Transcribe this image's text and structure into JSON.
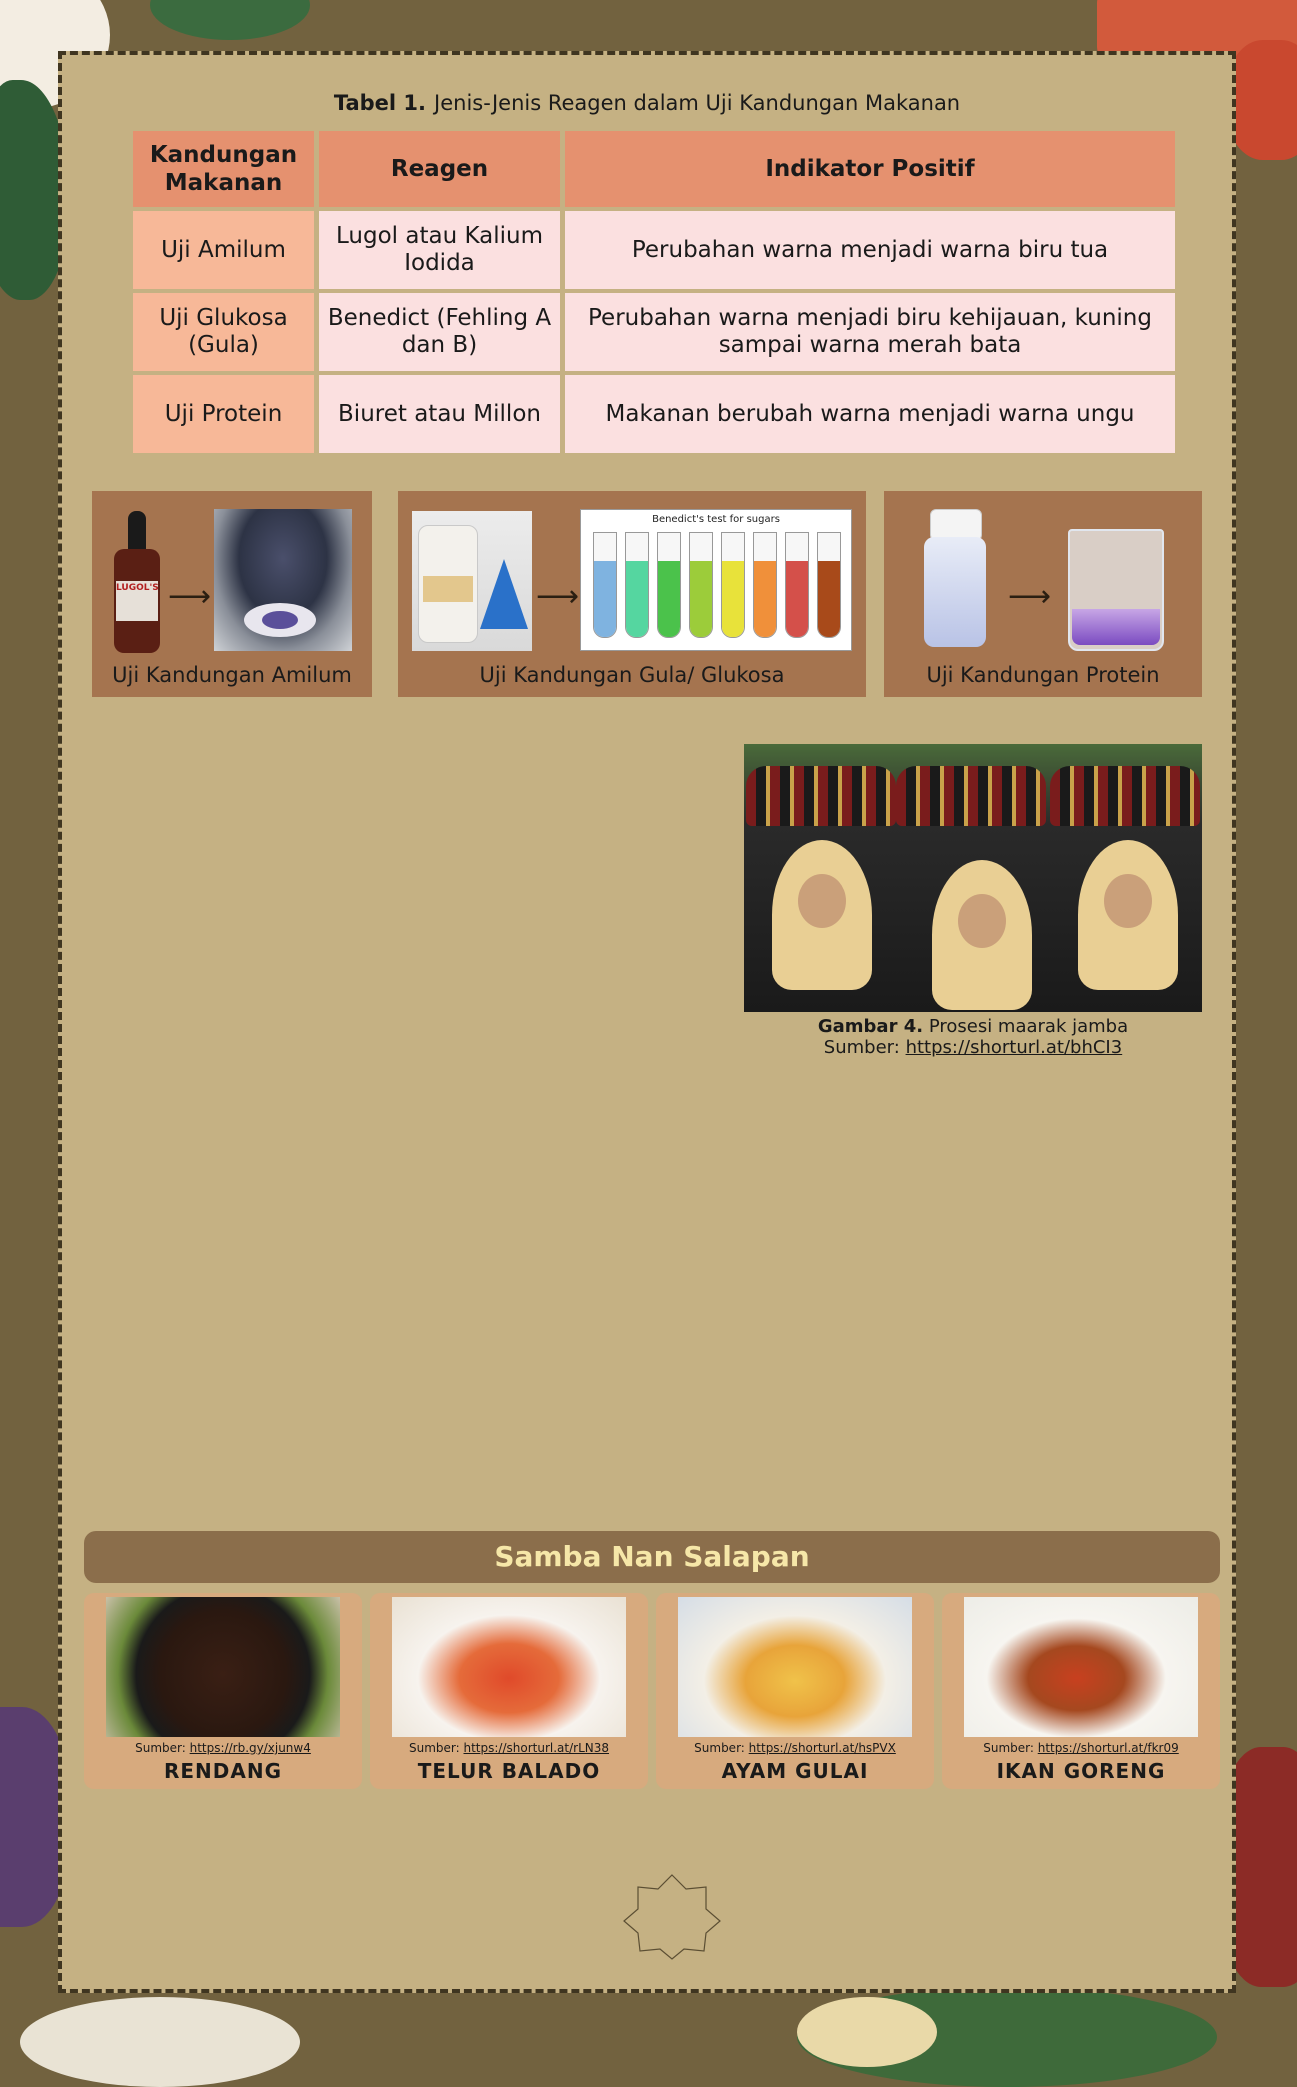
{
  "table": {
    "caption_label": "Tabel 1.",
    "caption_text": "Jenis-Jenis Reagen dalam Uji Kandungan Makanan",
    "headers": [
      "Kandungan Makanan",
      "Reagen",
      "Indikator Positif"
    ],
    "rows": [
      {
        "test": "Uji Amilum",
        "reagent": "Lugol atau Kalium Iodida",
        "indicator": "Perubahan warna menjadi warna biru tua"
      },
      {
        "test": "Uji Glukosa (Gula)",
        "reagent": "Benedict (Fehling A dan B)",
        "indicator": "Perubahan warna menjadi biru kehijauan, kuning sampai warna merah bata"
      },
      {
        "test": "Uji Protein",
        "reagent": "Biuret atau Millon",
        "indicator": "Makanan berubah warna menjadi warna ungu"
      }
    ]
  },
  "tests": {
    "amilum_label": "Uji Kandungan Amilum",
    "amilum_bottle_label": "LUGOL'S",
    "gula_label": "Uji Kandungan Gula/ Glukosa",
    "gula_chart_title": "Benedict's test for sugars",
    "protein_label": "Uji Kandungan Protein",
    "tube_colors": [
      "#7fb3e0",
      "#55d6a0",
      "#4bc24b",
      "#9ccc3a",
      "#e8e23a",
      "#f0903a",
      "#d4504a",
      "#a84a1a"
    ]
  },
  "figure4": {
    "label": "Gambar 4.",
    "text": "Prosesi maarak jamba",
    "source_label": "Sumber:",
    "source_url": "https://shorturl.at/bhCI3"
  },
  "samba": {
    "title": "Samba Nan Salapan",
    "source_label": "Sumber:",
    "foods": [
      {
        "name": "RENDANG",
        "url": "https://rb.gy/xjunw4"
      },
      {
        "name": "TELUR BALADO",
        "url": "https://shorturl.at/rLN38"
      },
      {
        "name": "AYAM GULAI",
        "url": "https://shorturl.at/hsPVX"
      },
      {
        "name": "IKAN GORENG",
        "url": "https://shorturl.at/fkr09"
      }
    ]
  },
  "colors": {
    "background": "#72623f",
    "panel": "#c5b183",
    "table_header": "#e5916f",
    "table_first_col": "#f7b898",
    "table_cell": "#fbe0e0",
    "test_box": "#a5744f",
    "samba_header": "#8b6e4b",
    "samba_title": "#f6e7a8",
    "food_card": "#d7aa7e"
  }
}
